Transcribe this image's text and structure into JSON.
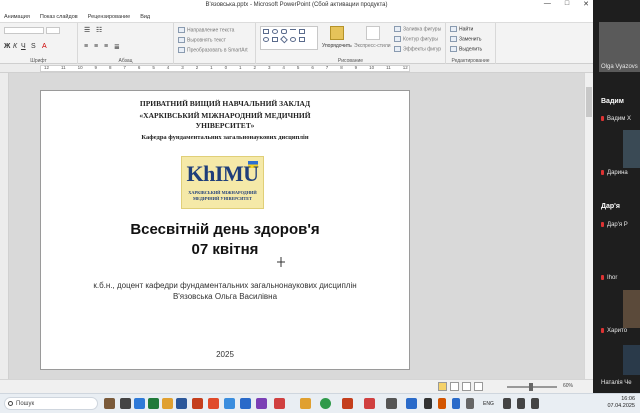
{
  "window": {
    "title": "В'язовська.pptx - Microsoft PowerPoint (Сбой активации продукта)",
    "minimize": "—",
    "maximize": "□",
    "close": "✕"
  },
  "ribbon_tabs": [
    "Анимация",
    "Показ слайдов",
    "Рецензирование",
    "Вид"
  ],
  "ribbon": {
    "groups": {
      "font": "Шрифт",
      "paragraph": "Абзац",
      "drawing": "Рисование",
      "editing": "Редактирование"
    },
    "paragraph_buttons": [
      "Направление текста",
      "Выровнять текст",
      "Преобразовать в SmartArt"
    ],
    "drawing_buttons": [
      "Упорядочить",
      "Экспресс-стили",
      "Заливка фигуры",
      "Контур фигуры",
      "Эффекты фигур"
    ],
    "editing_buttons": [
      "Найти",
      "Заменить",
      "Выделить"
    ]
  },
  "ruler_numbers": [
    "12",
    "11",
    "10",
    "9",
    "8",
    "7",
    "6",
    "5",
    "4",
    "3",
    "2",
    "1",
    "0",
    "1",
    "2",
    "3",
    "4",
    "5",
    "6",
    "7",
    "8",
    "9",
    "10",
    "11",
    "12"
  ],
  "slide": {
    "inst_line1": "ПРИВАТНИЙ ВИЩИЙ НАВЧАЛЬНИЙ ЗАКЛАД",
    "inst_line2": "«ХАРКІВСЬКИЙ МІЖНАРОДНИЙ МЕДИЧНИЙ",
    "inst_line3": "УНІВЕРСИТЕТ»",
    "department": "Кафедра фундаментальних загальнонаукових дисциплін",
    "logo_text": "KhIMU",
    "logo_sub1": "ХАРКІВСЬКИЙ МІЖНАРОДНИЙ",
    "logo_sub2": "МЕДИЧНИЙ УНІВЕРСИТЕТ",
    "title_line1": "Всесвітній день здоров'я",
    "title_line2": "07 квітня",
    "author_line1": "к.б.н., доцент кафедри фундаментальних загальнонаукових дисциплін",
    "author_line2": "В'язовська Ольга Василівна",
    "year": "2025"
  },
  "statusbar": {
    "zoom": "60%"
  },
  "taskbar": {
    "search_label": "Пошук",
    "lang": "ENG",
    "time": "16:06",
    "date": "07.04.2025"
  },
  "participants": {
    "self_label": "Olga Vyazovs",
    "section1": "Вадим",
    "p1": "Вадим Х",
    "p2": "Дарина",
    "section2": "Дар'я",
    "p3": "Дар'я Р",
    "p4": "Ihor",
    "p5": "Харито",
    "p6": "Наталія Че"
  },
  "colors": {
    "accent": "#2b579a",
    "slide_bg": "#ffffff",
    "workspace": "#d9d9d9",
    "panel": "#1e1e1e",
    "logo_bg": "#f5e9a8",
    "logo_text": "#1f3e7a"
  }
}
